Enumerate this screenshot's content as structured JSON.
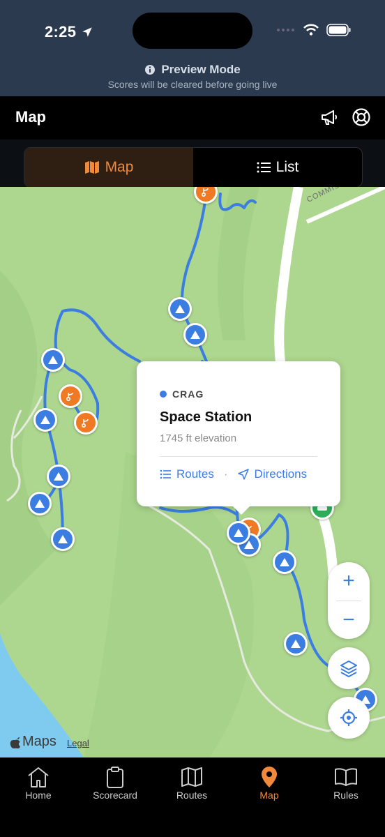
{
  "status": {
    "time": "2:25"
  },
  "preview": {
    "title": "Preview Mode",
    "subtitle": "Scores will be cleared before going live"
  },
  "header": {
    "title": "Map",
    "icons": [
      "megaphone-icon",
      "support-icon"
    ]
  },
  "toggle": {
    "map_label": "Map",
    "list_label": "List",
    "active": "Map"
  },
  "map": {
    "road_label": "COMMISSION",
    "popup": {
      "type": "CRAG",
      "name": "Space Station",
      "elevation": "1745 ft elevation",
      "routes_label": "Routes",
      "directions_label": "Directions",
      "separator": "·"
    },
    "attribution": {
      "brand": "Maps",
      "legal": "Legal"
    },
    "controls": {
      "zoom_in": "+",
      "zoom_out": "−"
    }
  },
  "tabs": [
    {
      "label": "Home"
    },
    {
      "label": "Scorecard"
    },
    {
      "label": "Routes"
    },
    {
      "label": "Map"
    },
    {
      "label": "Rules"
    }
  ],
  "colors": {
    "accent": "#f08a3a",
    "crag_blue": "#3b7de0",
    "route_orange": "#ef7a23",
    "parking_green": "#2fae5a"
  }
}
